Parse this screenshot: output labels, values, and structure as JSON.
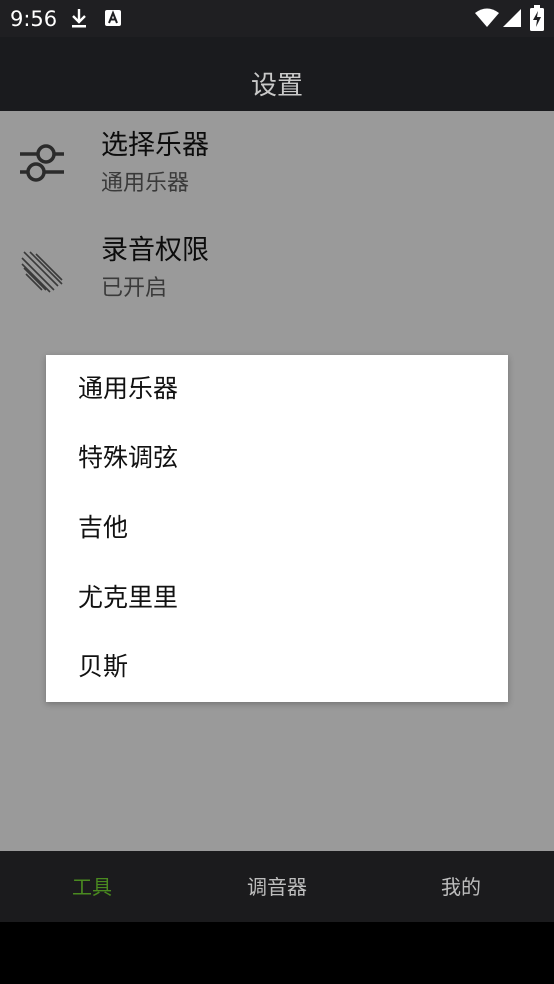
{
  "status_bar": {
    "time": "9:56",
    "icons": [
      "download-icon",
      "a-badge-icon",
      "wifi-icon",
      "signal-icon",
      "battery-charging-icon"
    ]
  },
  "app_bar": {
    "title": "设置"
  },
  "settings": [
    {
      "icon": "sliders-icon",
      "title": "选择乐器",
      "subtitle": "通用乐器"
    },
    {
      "icon": "mic-permission-icon",
      "title": "录音权限",
      "subtitle": "已开启"
    }
  ],
  "dialog": {
    "options": [
      "通用乐器",
      "特殊调弦",
      "吉他",
      "尤克里里",
      "贝斯"
    ]
  },
  "bottom_nav": {
    "tabs": [
      "工具",
      "调音器",
      "我的"
    ],
    "active_index": 0
  },
  "colors": {
    "accent": "#4a8a20",
    "overlay": "#9a9a9a",
    "bar_dark": "#1a1b1e"
  }
}
